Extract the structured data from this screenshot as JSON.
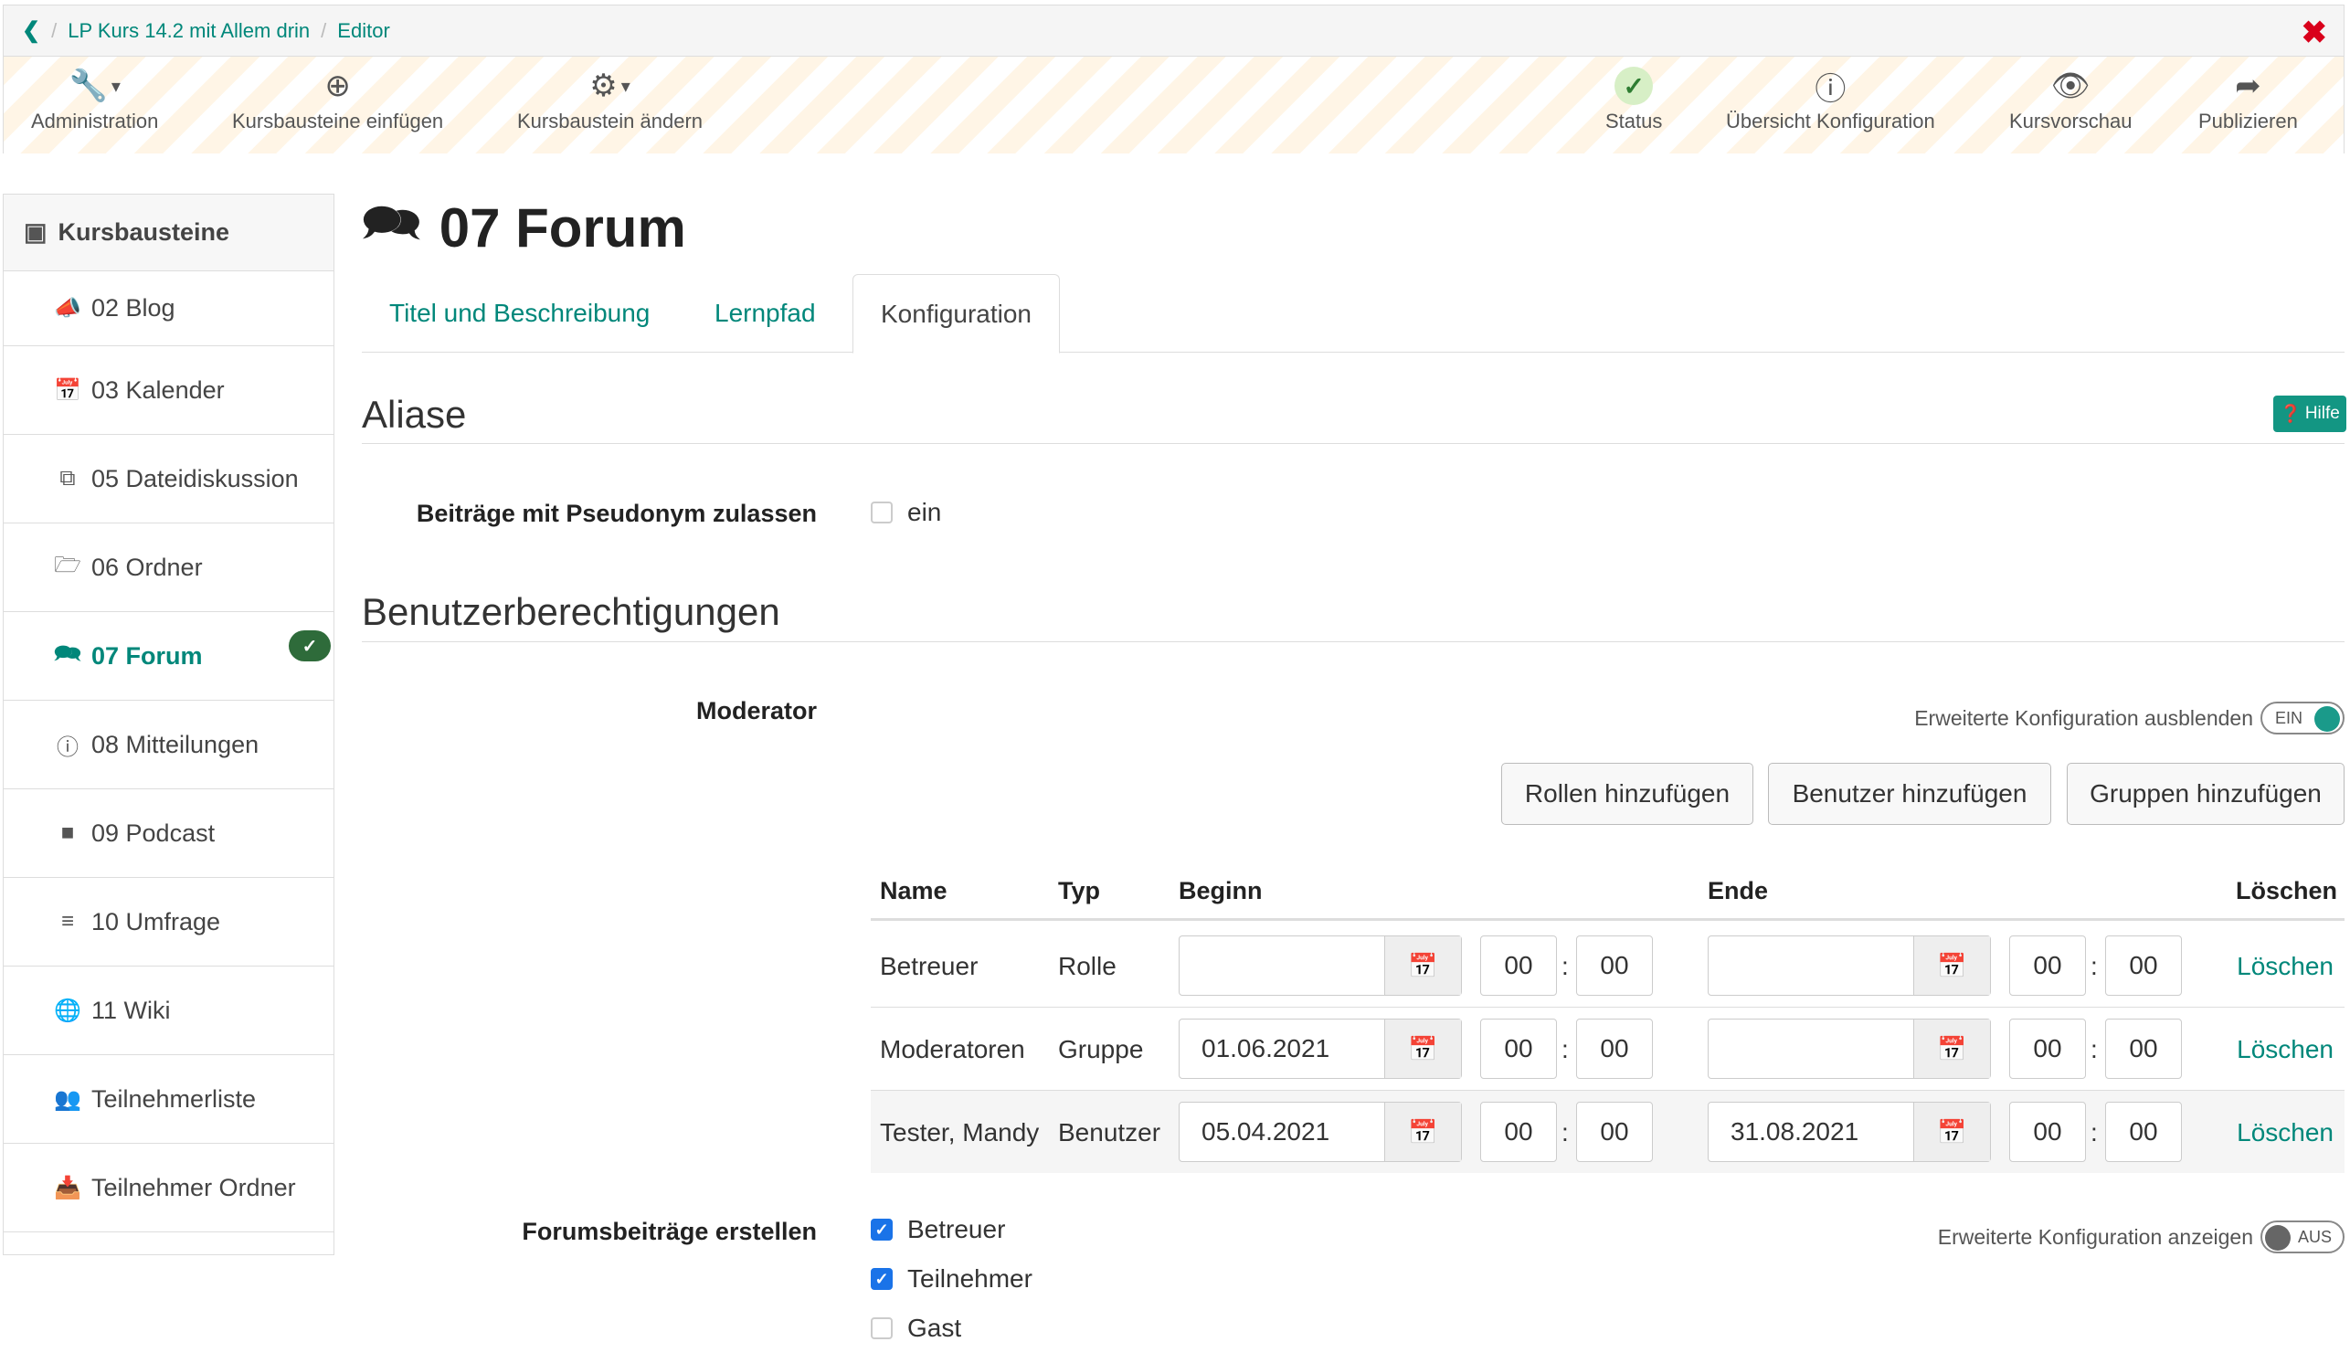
{
  "breadcrumb": {
    "back_icon": "chevron-left-icon",
    "items": [
      "LP Kurs 14.2 mit Allem drin",
      "Editor"
    ]
  },
  "toolbar": {
    "left": [
      {
        "icon": "wrench-icon",
        "label": "Administration"
      },
      {
        "icon": "plus-circle-icon",
        "label": "Kursbausteine einfügen"
      },
      {
        "icon": "gear-icon",
        "label": "Kursbaustein ändern"
      }
    ],
    "right": [
      {
        "icon": "check-icon",
        "label": "Status"
      },
      {
        "icon": "info-icon",
        "label": "Übersicht Konfiguration"
      },
      {
        "icon": "eye-icon",
        "label": "Kursvorschau"
      },
      {
        "icon": "share-icon",
        "label": "Publizieren"
      }
    ],
    "close_icon": "close-icon"
  },
  "sidebar": {
    "title": "Kursbausteine",
    "items": [
      {
        "icon": "megaphone-icon",
        "label": "02 Blog"
      },
      {
        "icon": "calendar-icon",
        "label": "03 Kalender"
      },
      {
        "icon": "copy-icon",
        "label": "05 Dateidiskussion"
      },
      {
        "icon": "folder-icon",
        "label": "06 Ordner"
      },
      {
        "icon": "comments-icon",
        "label": "07 Forum",
        "active": true
      },
      {
        "icon": "info-icon",
        "label": "08 Mitteilungen"
      },
      {
        "icon": "video-icon",
        "label": "09 Podcast"
      },
      {
        "icon": "sliders-icon",
        "label": "10 Umfrage"
      },
      {
        "icon": "globe-icon",
        "label": "11 Wiki"
      },
      {
        "icon": "users-icon",
        "label": "Teilnehmerliste"
      },
      {
        "icon": "inbox-icon",
        "label": "Teilnehmer Ordner"
      }
    ]
  },
  "page": {
    "title": "07 Forum",
    "tabs": [
      "Titel und Beschreibung",
      "Lernpfad",
      "Konfiguration"
    ],
    "active_tab": "Konfiguration"
  },
  "aliases": {
    "heading": "Aliase",
    "help_label": "Hilfe",
    "pseudonym_label": "Beiträge mit Pseudonym zulassen",
    "pseudonym_option": "ein",
    "pseudonym_checked": false
  },
  "permissions": {
    "heading": "Benutzerberechtigungen",
    "moderator_label": "Moderator",
    "advanced_hide_label": "Erweiterte Konfiguration ausblenden",
    "toggle_on": "EIN",
    "buttons": [
      "Rollen hinzufügen",
      "Benutzer hinzufügen",
      "Gruppen hinzufügen"
    ],
    "table": {
      "headers": [
        "Name",
        "Typ",
        "Beginn",
        "Ende",
        "Löschen"
      ],
      "rows": [
        {
          "name": "Betreuer",
          "type": "Rolle",
          "begin_date": "",
          "begin_h": "00",
          "begin_m": "00",
          "end_date": "",
          "end_h": "00",
          "end_m": "00",
          "delete": "Löschen"
        },
        {
          "name": "Moderatoren",
          "type": "Gruppe",
          "begin_date": "01.06.2021",
          "begin_h": "00",
          "begin_m": "00",
          "end_date": "",
          "end_h": "00",
          "end_m": "00",
          "delete": "Löschen"
        },
        {
          "name": "Tester, Mandy",
          "type": "Benutzer",
          "begin_date": "05.04.2021",
          "begin_h": "00",
          "begin_m": "00",
          "end_date": "31.08.2021",
          "end_h": "00",
          "end_m": "00",
          "delete": "Löschen"
        }
      ]
    },
    "forum_posts_label": "Forumsbeiträge erstellen",
    "advanced_show_label": "Erweiterte Konfiguration anzeigen",
    "toggle_off": "AUS",
    "options": [
      {
        "label": "Betreuer",
        "checked": true
      },
      {
        "label": "Teilnehmer",
        "checked": true
      },
      {
        "label": "Gast",
        "checked": false
      }
    ]
  },
  "colors": {
    "accent": "#00877a",
    "help": "#139683",
    "close": "#d9001b",
    "badge": "#2e6b3a"
  }
}
